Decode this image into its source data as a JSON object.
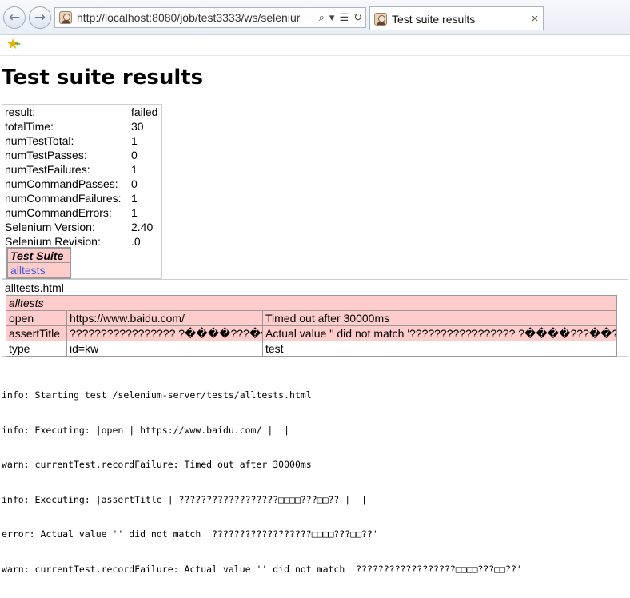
{
  "browser": {
    "url": "http://localhost:8080/job/test3333/ws/seleniur",
    "tab_title": "Test suite results",
    "tab_close": "×",
    "back_glyph": "←",
    "forward_glyph": "→"
  },
  "page": {
    "title": "Test suite results",
    "summary": [
      {
        "key": "result:",
        "value": "failed"
      },
      {
        "key": "totalTime:",
        "value": "30"
      },
      {
        "key": "numTestTotal:",
        "value": "1"
      },
      {
        "key": "numTestPasses:",
        "value": "0"
      },
      {
        "key": "numTestFailures:",
        "value": "1"
      },
      {
        "key": "numCommandPasses:",
        "value": "0"
      },
      {
        "key": "numCommandFailures:",
        "value": "1"
      },
      {
        "key": "numCommandErrors:",
        "value": "1"
      },
      {
        "key": "Selenium Version:",
        "value": "2.40"
      },
      {
        "key": "Selenium Revision:",
        "value": ".0"
      }
    ],
    "suite": {
      "header": "Test Suite",
      "link": "alltests"
    },
    "test_file": "alltests.html",
    "test_table": {
      "title": "alltests",
      "rows": [
        {
          "command": "open",
          "target": "https://www.baidu.com/",
          "value": "Timed out after 30000ms",
          "status": "fail"
        },
        {
          "command": "assertTitle",
          "target": "????????????????? ?����???��??",
          "value": "Actual value '' did not match '????????????????? ?����???��??'",
          "status": "fail"
        },
        {
          "command": "type",
          "target": "id=kw",
          "value": "test",
          "status": "plain"
        }
      ]
    },
    "log": [
      "info: Starting test /selenium-server/tests/alltests.html",
      "info: Executing: |open | https://www.baidu.com/ |  |",
      "warn: currentTest.recordFailure: Timed out after 30000ms",
      "info: Executing: |assertTitle | ??????????????????□□□□???□□?? |  |",
      "error: Actual value '' did not match '??????????????????□□□□???□□??'",
      "warn: currentTest.recordFailure: Actual value '' did not match '??????????????????□□□□???□□??'"
    ]
  }
}
